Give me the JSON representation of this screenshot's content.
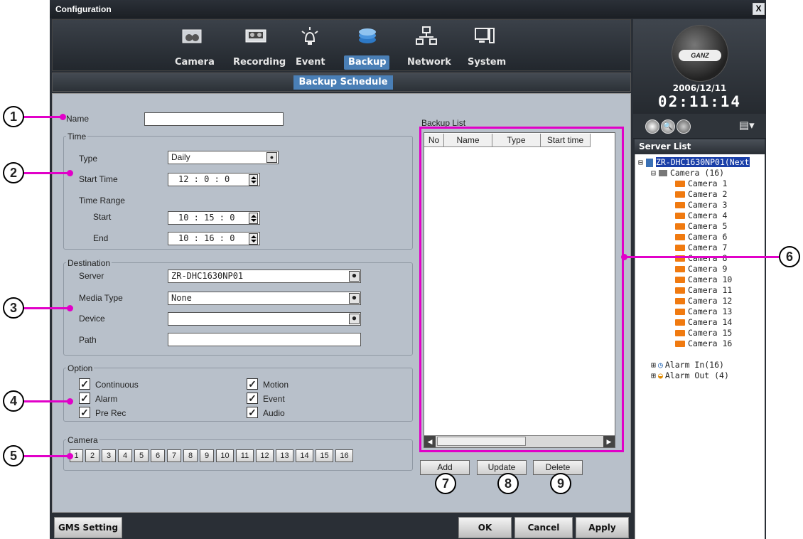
{
  "window": {
    "title": "Configuration",
    "close_glyph": "X"
  },
  "tabs": [
    {
      "label": "Camera",
      "icon": "camera-icon"
    },
    {
      "label": "Recording",
      "icon": "recording-icon"
    },
    {
      "label": "Event",
      "icon": "event-icon"
    },
    {
      "label": "Backup",
      "icon": "backup-icon",
      "active": true
    },
    {
      "label": "Network",
      "icon": "network-icon"
    },
    {
      "label": "System",
      "icon": "system-icon"
    }
  ],
  "subtitle": "Backup Schedule",
  "form": {
    "name_label": "Name",
    "name_value": "",
    "time_group": "Time",
    "type_label": "Type",
    "type_value": "Daily",
    "start_time_label": "Start Time",
    "start_time_value": "12 : 0 : 0",
    "time_range_label": "Time Range",
    "start_label": "Start",
    "start_value": "10 : 15 : 0",
    "end_label": "End",
    "end_value": "10 : 16 : 0",
    "destination_group": "Destination",
    "server_label": "Server",
    "server_value": "ZR-DHC1630NP01",
    "media_label": "Media Type",
    "media_value": "None",
    "device_label": "Device",
    "device_value": "",
    "path_label": "Path",
    "path_value": "",
    "option_group": "Option",
    "options": [
      {
        "label": "Continuous",
        "checked": true
      },
      {
        "label": "Alarm",
        "checked": true
      },
      {
        "label": "Pre Rec",
        "checked": true
      },
      {
        "label": "Motion",
        "checked": true
      },
      {
        "label": "Event",
        "checked": true
      },
      {
        "label": "Audio",
        "checked": true
      }
    ],
    "camera_group": "Camera",
    "cameras": [
      "1",
      "2",
      "3",
      "4",
      "5",
      "6",
      "7",
      "8",
      "9",
      "10",
      "11",
      "12",
      "13",
      "14",
      "15",
      "16"
    ]
  },
  "backup_list": {
    "title": "Backup List",
    "columns": [
      "No",
      "Name",
      "Type",
      "Start time"
    ],
    "rows": []
  },
  "list_buttons": {
    "add": "Add",
    "update": "Update",
    "delete": "Delete"
  },
  "footer": {
    "gms": "GMS Setting",
    "ok": "OK",
    "cancel": "Cancel",
    "apply": "Apply"
  },
  "clock": {
    "date": "2006/12/11",
    "time": "02:11:14",
    "brand": "GANZ"
  },
  "server_list": {
    "title": "Server List",
    "server": "ZR-DHC1630NP01(Next",
    "camera_group": "Camera (16)",
    "cameras": [
      "Camera 1",
      "Camera 2",
      "Camera 3",
      "Camera 4",
      "Camera 5",
      "Camera 6",
      "Camera 7",
      "Camera 8",
      "Camera 9",
      "Camera 10",
      "Camera 11",
      "Camera 12",
      "Camera 13",
      "Camera 14",
      "Camera 15",
      "Camera 16"
    ],
    "alarm_in": "Alarm In(16)",
    "alarm_out": "Alarm Out (4)"
  },
  "callouts": [
    "1",
    "2",
    "3",
    "4",
    "5",
    "6",
    "7",
    "8",
    "9"
  ],
  "colors": {
    "callout": "#e100c8",
    "accent": "#4a7fb6",
    "panel": "#b8c0ca"
  }
}
